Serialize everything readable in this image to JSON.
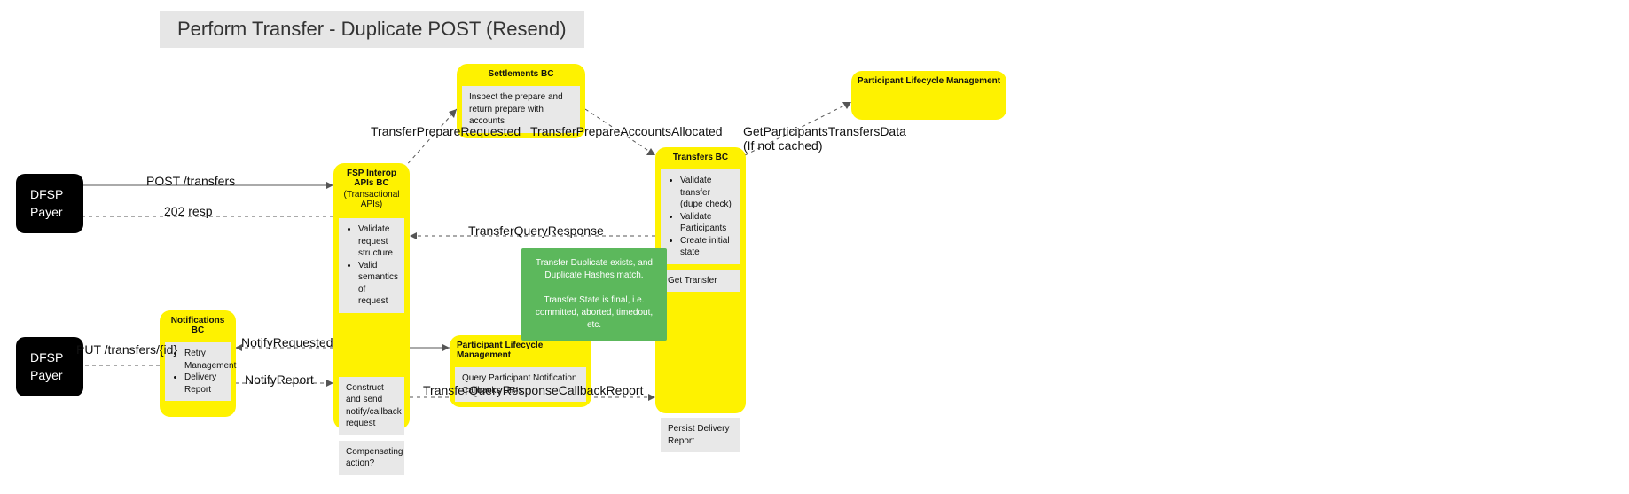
{
  "title": "Perform Transfer - Duplicate POST (Resend)",
  "actors": {
    "dfsp_payer_1": "DFSP\nPayer",
    "dfsp_payer_2": "DFSP\nPayer"
  },
  "fsp_interop": {
    "title": "FSP Interop APIs BC",
    "subtitle": "(Transactional APIs)",
    "cell1_items": [
      "Validate request structure",
      "Valid semantics of request"
    ],
    "cell2": "Construct and send notify/callback request",
    "cell3": "Compensating action?"
  },
  "settlements": {
    "title": "Settlements BC",
    "cell1": "Inspect the prepare and return prepare with accounts"
  },
  "transfers": {
    "title": "Transfers BC",
    "cell1_items": [
      "Validate transfer (dupe check)",
      "Validate Participants",
      "Create initial state"
    ],
    "cell2": "Get Transfer",
    "cell3": "Persist Delivery Report"
  },
  "participant_lm_small": {
    "title": "Participant Lifecycle Management",
    "cell1": "Query Participant Notification Callbacks URIs"
  },
  "participant_lm_top": {
    "title": "Participant Lifecycle Management"
  },
  "notifications": {
    "title": "Notifications BC",
    "cell1_items": [
      "Retry Management",
      "Delivery Report"
    ]
  },
  "green_note": "Transfer Duplicate exists, and Duplicate Hashes match.\n\nTransfer State is final, i.e. committed, aborted, timedout, etc.",
  "edges": {
    "post_transfers": "POST /transfers",
    "resp_202": "202 resp",
    "transfer_prepare_requested": "TransferPrepareRequested",
    "transfer_prepare_accounts_allocated": "TransferPrepareAccountsAllocated",
    "get_participants": "GetParticipantsTransfersData\n(If not cached)",
    "transfer_query_response": "TransferQueryResponse",
    "notify_requested": "NotifyRequested",
    "notify_report": "NotifyReport",
    "put_transfers": "PUT /transfers/{id}",
    "tqr_callback_report": "TransferQueryResponseCallbackReport"
  }
}
